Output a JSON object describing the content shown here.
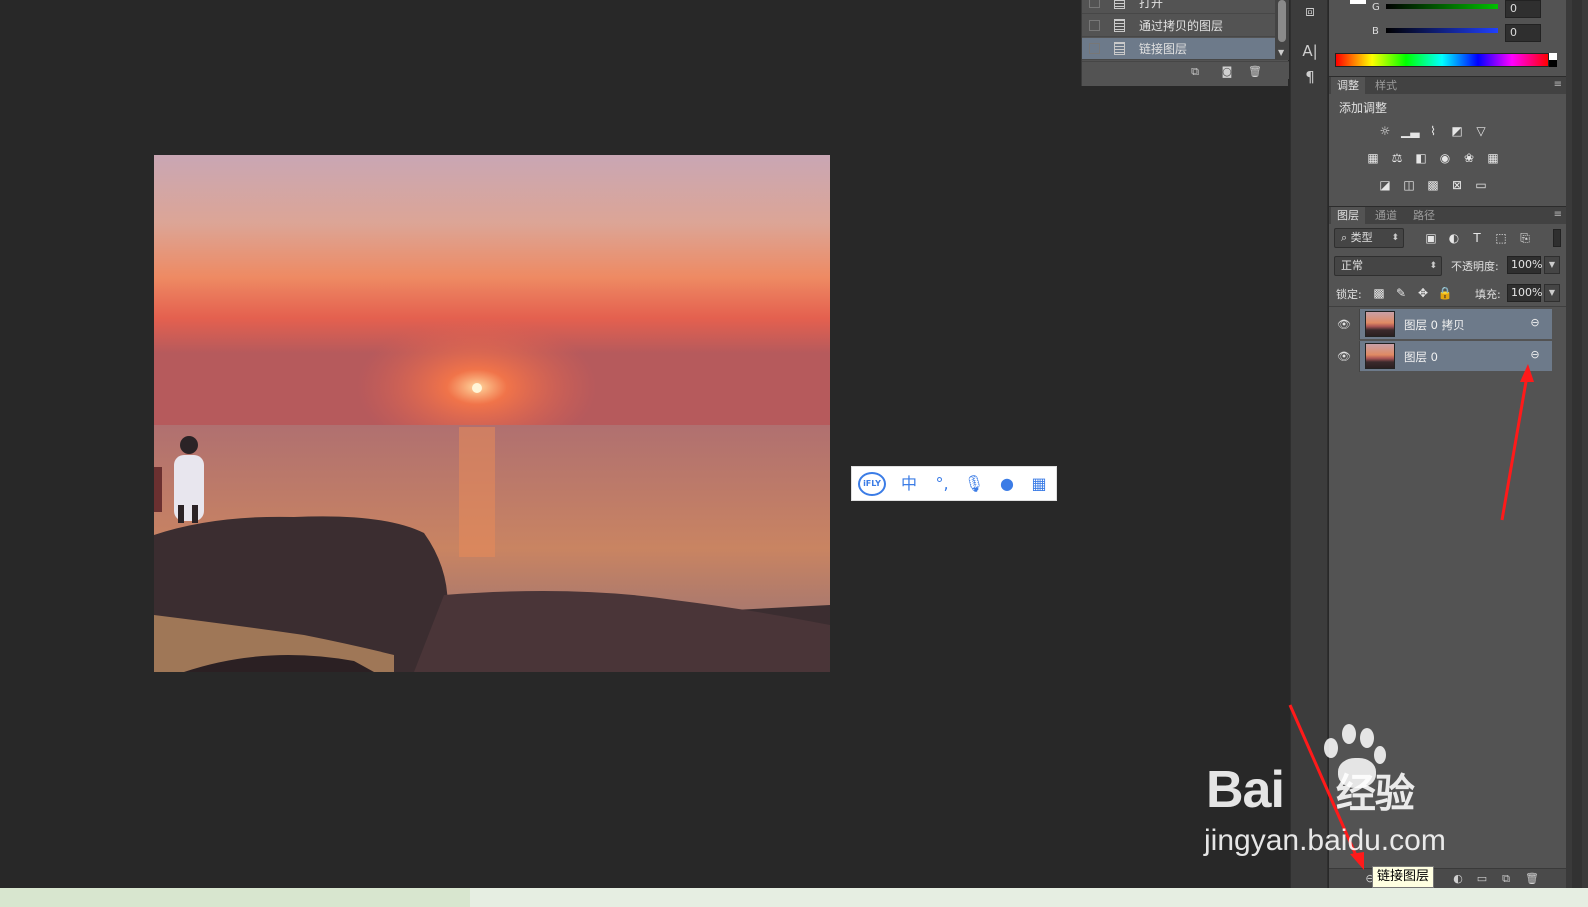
{
  "history_panel": {
    "items": [
      {
        "label": "打开"
      },
      {
        "label": "通过拷贝的图层"
      },
      {
        "label": "链接图层",
        "selected": true
      }
    ],
    "buttons": [
      "new-document-from-state-icon",
      "camera-icon",
      "trash-icon"
    ]
  },
  "color_panel": {
    "channels": [
      {
        "name": "G",
        "value": "0",
        "color": "#00c000"
      },
      {
        "name": "B",
        "value": "0",
        "color": "#2040ff"
      }
    ]
  },
  "adjustments_panel": {
    "tabs": [
      "调整",
      "样式"
    ],
    "active_tab": "调整",
    "heading": "添加调整",
    "icons_row1": [
      "brightness-icon",
      "levels-icon",
      "curves-icon",
      "exposure-icon",
      "vibrance-icon"
    ],
    "icons_row2": [
      "hue-saturation-icon",
      "color-balance-icon",
      "black-white-icon",
      "photo-filter-icon",
      "channel-mixer-icon",
      "color-lookup-icon"
    ],
    "icons_row3": [
      "invert-icon",
      "posterize-icon",
      "threshold-icon",
      "selective-color-icon",
      "gradient-map-icon"
    ]
  },
  "layers_panel": {
    "tabs": [
      "图层",
      "通道",
      "路径"
    ],
    "active_tab": "图层",
    "filter_label": "类型",
    "blend_mode": "正常",
    "opacity_label": "不透明度:",
    "opacity_value": "100%",
    "lock_label": "锁定:",
    "fill_label": "填充:",
    "fill_value": "100%",
    "layers": [
      {
        "name": "图层 0 拷贝",
        "visible": true,
        "linked": true
      },
      {
        "name": "图层 0",
        "visible": true,
        "linked": true
      }
    ],
    "tooltip": "链接图层"
  },
  "ime_toolbar": {
    "logo": "iFLY",
    "mode": "中",
    "punct": "°,"
  },
  "watermark": {
    "brand": "Bai",
    "brand_tail": "经验",
    "url": "jingyan.baidu.com"
  },
  "colors": {
    "panel_bg": "#535353",
    "workspace_bg": "#282828",
    "selected_row": "#6d7a8a",
    "annotation_red": "#ff1a1a",
    "ime_blue": "#3b7ce6"
  }
}
